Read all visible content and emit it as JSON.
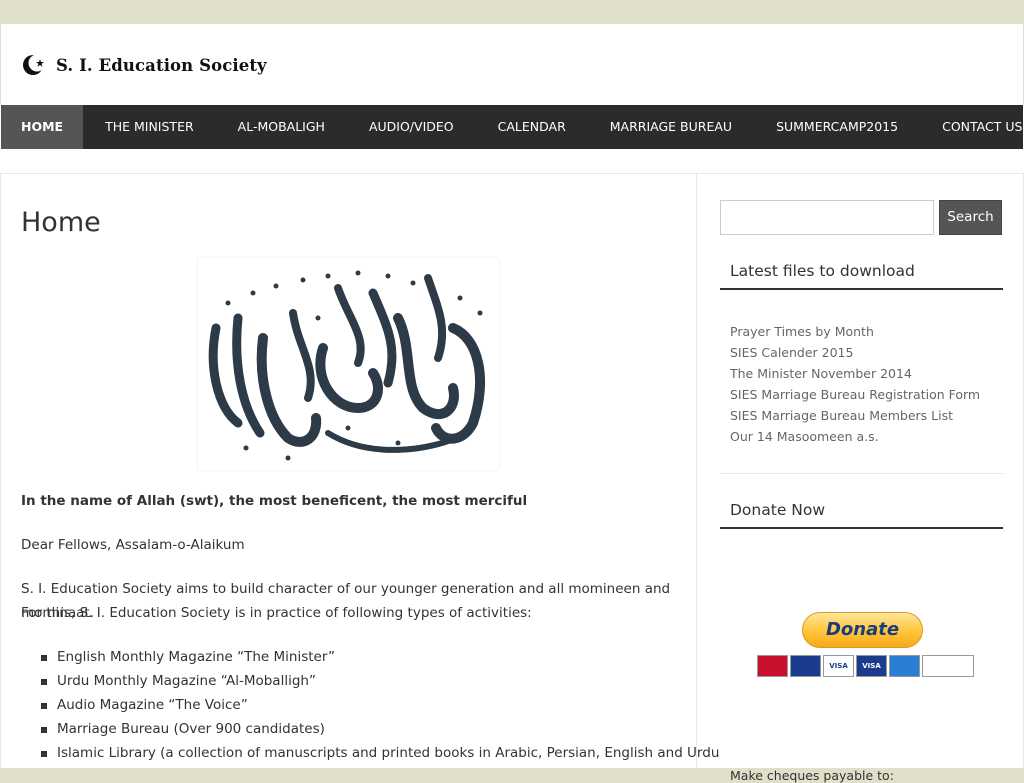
{
  "site": {
    "name": "S. I. Education Society"
  },
  "nav": {
    "items": [
      {
        "label": "HOME",
        "active": true
      },
      {
        "label": "THE MINISTER"
      },
      {
        "label": "AL-MOBALIGH"
      },
      {
        "label": "AUDIO/VIDEO"
      },
      {
        "label": "CALENDAR"
      },
      {
        "label": "MARRIAGE BUREAU"
      },
      {
        "label": "SUMMERCAMP2015"
      },
      {
        "label": "CONTACT US"
      }
    ]
  },
  "main": {
    "title": "Home",
    "bismillah": "In the name of Allah (swt), the most beneficent, the most merciful",
    "greeting": "Dear Fellows, Assalam-o-Alaikum",
    "intro_line1": "S. I. Education Society aims to build character of our younger generation and all momineen and mominaat.",
    "intro_line2": "For this, S. I. Education Society is in practice of following types of activities:",
    "activities": [
      "English Monthly Magazine “The Minister”",
      "Urdu Monthly Magazine “Al-Moballigh”",
      "Audio Magazine “The Voice”",
      "Marriage Bureau (Over 900 candidates)",
      "Islamic Library (a collection of manuscripts and printed books in Arabic, Persian, English and Urdu"
    ]
  },
  "sidebar": {
    "search_button": "Search",
    "search_placeholder": "",
    "files_title": "Latest files to download",
    "files": [
      "Prayer Times by Month",
      "SIES Calender 2015",
      "The Minister November 2014",
      "SIES Marriage Bureau Registration Form",
      "SIES Marriage Bureau Members List",
      "Our 14 Masoomeen a.s."
    ],
    "donate_title": "Donate Now",
    "donate_button": "Donate",
    "cards": [
      "MasterCard",
      "Maestro",
      "VISA",
      "VISA",
      "AMEX",
      "DIRECT Debit"
    ],
    "cheques": "Make cheques payable to:"
  },
  "colors": {
    "top_band": "#dfdfca",
    "nav_bg": "#2b2b2b",
    "nav_active": "#555555",
    "donate_yellow": "#ffc43a"
  }
}
